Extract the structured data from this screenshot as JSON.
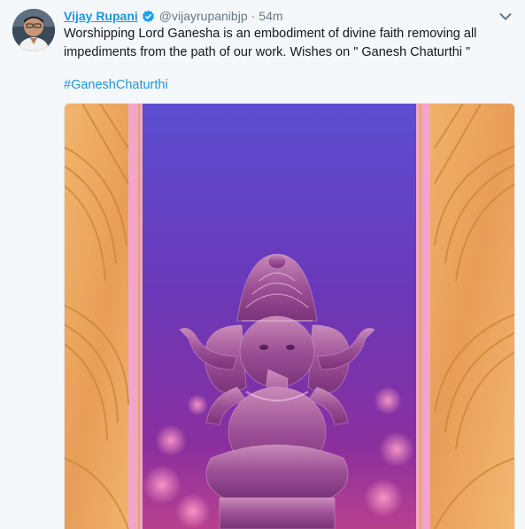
{
  "tweet": {
    "author_name": "Vijay Rupani",
    "author_handle": "@vijayrupanibjp",
    "separator": "·",
    "timestamp": "54m",
    "text": "Worshipping Lord Ganesha is an embodiment of divine faith removing all impediments from the path of our work. Wishes on \" Ganesh Chaturthi \"",
    "hashtag": "#GaneshChaturthi"
  },
  "icons": {
    "verified": "verified-badge-icon",
    "caret": "chevron-down-icon"
  },
  "colors": {
    "link": "#1b95e0",
    "muted": "#657786",
    "background": "#f5f8fa",
    "gold": "#e9a45a",
    "purple": "#5b3fc9",
    "pink": "#f09ac6"
  }
}
